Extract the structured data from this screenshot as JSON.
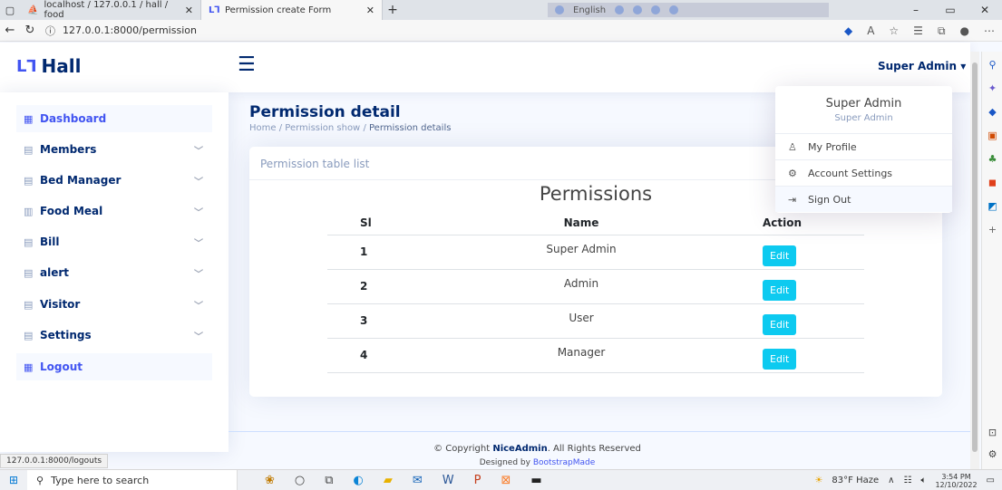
{
  "browser": {
    "tabs": [
      {
        "title": "localhost / 127.0.0.1 / hall / food",
        "active": false
      },
      {
        "title": "Permission create Form",
        "active": true
      }
    ],
    "language_pill": "English",
    "url": "127.0.0.1:8000/permission",
    "status_url": "127.0.0.1:8000/logouts"
  },
  "header": {
    "logo_text": "Hall",
    "user_name": "Super Admin"
  },
  "sidebar": {
    "items": [
      {
        "label": "Dashboard",
        "icon": "grid-icon",
        "has_chevron": false
      },
      {
        "label": "Members",
        "icon": "doc-icon",
        "has_chevron": true
      },
      {
        "label": "Bed Manager",
        "icon": "layout-icon",
        "has_chevron": true
      },
      {
        "label": "Food Meal",
        "icon": "table-icon",
        "has_chevron": true
      },
      {
        "label": "Bill",
        "icon": "doc-icon",
        "has_chevron": true
      },
      {
        "label": "alert",
        "icon": "doc-icon",
        "has_chevron": true
      },
      {
        "label": "Visitor",
        "icon": "doc-icon",
        "has_chevron": true
      },
      {
        "label": "Settings",
        "icon": "doc-icon",
        "has_chevron": true
      },
      {
        "label": "Logout",
        "icon": "grid-icon",
        "has_chevron": false
      }
    ]
  },
  "page": {
    "title": "Permission detail",
    "breadcrumb": [
      "Home",
      "Permission show",
      "Permission details"
    ]
  },
  "card": {
    "heading": "Permission table list",
    "table_title": "Permissions",
    "columns": [
      "Sl",
      "Name",
      "Action"
    ],
    "rows": [
      {
        "sl": "1",
        "name": "Super Admin",
        "action": "Edit"
      },
      {
        "sl": "2",
        "name": "Admin",
        "action": "Edit"
      },
      {
        "sl": "3",
        "name": "User",
        "action": "Edit"
      },
      {
        "sl": "4",
        "name": "Manager",
        "action": "Edit"
      }
    ]
  },
  "dropdown": {
    "name": "Super Admin",
    "role": "Super Admin",
    "items": [
      {
        "label": "My Profile",
        "icon": "person-icon"
      },
      {
        "label": "Account Settings",
        "icon": "gear-icon"
      },
      {
        "label": "Sign Out",
        "icon": "sign-out-icon"
      }
    ]
  },
  "footer": {
    "copyright_prefix": "© Copyright",
    "brand": "NiceAdmin",
    "copyright_suffix": ". All Rights Reserved",
    "designed_prefix": "Designed by",
    "designed_link": "BootstrapMade"
  },
  "taskbar": {
    "search_placeholder": "Type here to search",
    "weather": "83°F  Haze",
    "time": "3:54 PM",
    "date": "12/10/2022"
  },
  "colors": {
    "brand": "#012970",
    "accent": "#4154f1",
    "edit_button": "#0dcaf0"
  }
}
